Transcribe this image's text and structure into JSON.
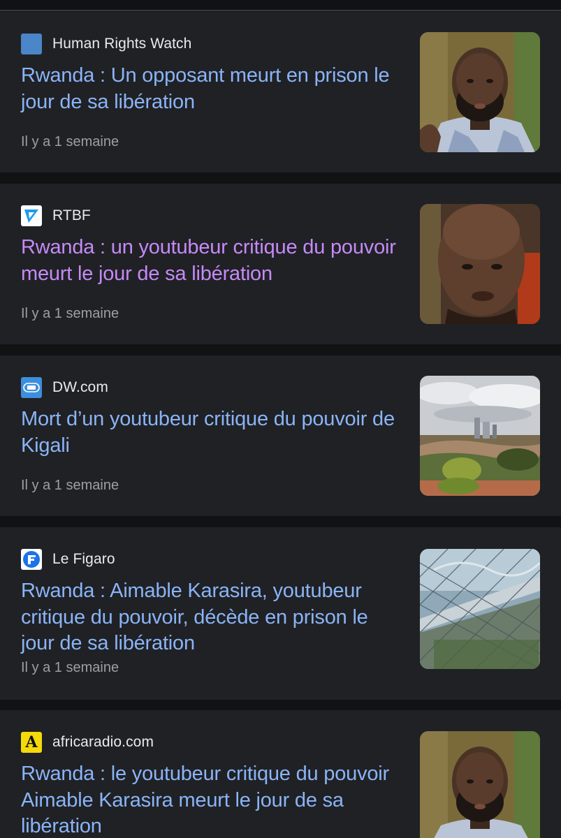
{
  "articles": [
    {
      "source": "Human Rights Watch",
      "favicon_icon": "hrw-logo-icon",
      "headline": "Rwanda : Un opposant meurt en prison le jour de sa libération",
      "time": "Il y a 1 semaine",
      "visited": false,
      "thumbnail": "portrait-man-plaid-shirt"
    },
    {
      "source": "RTBF",
      "favicon_icon": "rtbf-logo-icon",
      "headline": "Rwanda : un youtubeur critique du pouvoir meurt le jour de sa libération",
      "time": "Il y a 1 semaine",
      "visited": true,
      "thumbnail": "portrait-man-closeup"
    },
    {
      "source": "DW.com",
      "favicon_icon": "dw-logo-icon",
      "headline": "Mort d’un youtubeur critique du pouvoir de Kigali",
      "time": "Il y a 1 semaine",
      "visited": false,
      "thumbnail": "kigali-cityscape"
    },
    {
      "source": "Le Figaro",
      "favicon_icon": "le-figaro-logo-icon",
      "headline": "Rwanda : Aimable Karasira, youtubeur critique du pouvoir, décède en prison le jour de sa libération",
      "time": "Il y a 1 semaine",
      "visited": false,
      "thumbnail": "prison-fence-barbed-wire"
    },
    {
      "source": "africaradio.com",
      "favicon_icon": "africaradio-logo-icon",
      "favicon_letter": "A",
      "headline": "Rwanda : le youtubeur critique du pouvoir Aimable Karasira meurt le jour de sa libération",
      "time": "",
      "visited": false,
      "thumbnail": "portrait-man-plaid-shirt"
    }
  ],
  "colors": {
    "background": "#111214",
    "card": "#202124",
    "headline": "#8ab4f8",
    "headline_visited": "#c58af9",
    "source": "#e8eaed",
    "time": "#9aa0a6"
  }
}
